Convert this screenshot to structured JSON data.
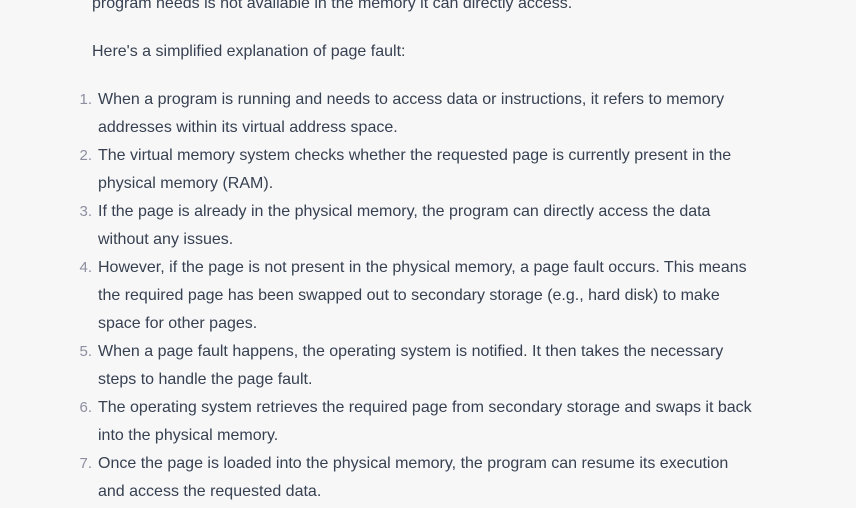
{
  "message": {
    "intro_tail": "program needs is not available in the memory it can directly access.",
    "intro": "Here's a simplified explanation of page fault:",
    "steps": [
      {
        "num": "1.",
        "text": "When a program is running and needs to access data or instructions, it refers to memory addresses within its virtual address space."
      },
      {
        "num": "2.",
        "text": "The virtual memory system checks whether the requested page is currently present in the physical memory (RAM)."
      },
      {
        "num": "3.",
        "text": "If the page is already in the physical memory, the program can directly access the data without any issues."
      },
      {
        "num": "4.",
        "text": "However, if the page is not present in the physical memory, a page fault occurs. This means the required page has been swapped out to secondary storage (e.g., hard disk) to make space for other pages."
      },
      {
        "num": "5.",
        "text": "When a page fault happens, the operating system is notified. It then takes the necessary steps to handle the page fault."
      },
      {
        "num": "6.",
        "text": "The operating system retrieves the required page from secondary storage and swaps it back into the physical memory."
      },
      {
        "num": "7.",
        "text": "Once the page is loaded into the physical memory, the program can resume its execution and access the requested data."
      }
    ]
  }
}
